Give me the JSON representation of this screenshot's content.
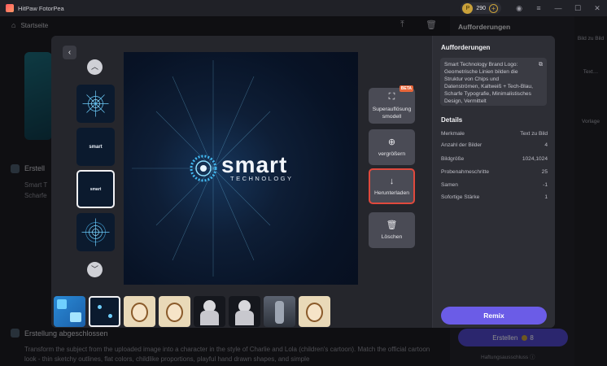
{
  "app": {
    "name": "HitPaw FotorPea"
  },
  "titlebar": {
    "credits": "290",
    "coin_symbol": "P",
    "plus": "+"
  },
  "header": {
    "home_label": "Startseite"
  },
  "right_panel": {
    "title": "Aufforderungen",
    "create_label": "Erstellen",
    "create_count": "8",
    "help_label": "Haftungsausschluss ⓘ"
  },
  "sidebar": {
    "items": [
      {
        "label": "Bild zu Bild"
      },
      {
        "label": "Text…"
      },
      {
        "label": "Vorlage"
      }
    ]
  },
  "background": {
    "item1_title": "Erstell",
    "item1_sub1": "Smart T",
    "item1_sub2": "Scharfe",
    "item2_title": "Erstellung abgeschlossen",
    "item2_text": "Transform the subject from the uploaded image into a character in the style of Charlie and Lola (children's cartoon). Match the official cartoon look - thin sketchy outlines, flat colors, childlike proportions, playful hand drawn shapes, and simple"
  },
  "modal": {
    "image": {
      "wordmark": "smart",
      "sub": "TECHNOLOGY"
    },
    "thumb_word": "smart",
    "actions": [
      {
        "label": "Superauflösungsmodell",
        "icon": "super-resolution-icon",
        "badge": "BETA"
      },
      {
        "label": "vergrößern",
        "icon": "zoom-in-icon"
      },
      {
        "label": "Herunterladen",
        "icon": "download-icon"
      },
      {
        "label": "Löschen",
        "icon": "trash-icon"
      }
    ],
    "side": {
      "prompt_title": "Aufforderungen",
      "prompt_text": "Smart Technology Brand Logo: Geometrische Linien bilden die Struktur von Chips und Datenströmen, Kaltweiß + Tech-Blau, Scharfe Typografie, Minimalistisches Design, Vermittelt",
      "details_title": "Details",
      "details": [
        {
          "label": "Merkmale",
          "value": "Text zu Bild"
        },
        {
          "label": "Anzahl der Bilder",
          "value": "4"
        },
        {
          "label": "Bildgröße",
          "value": "1024,1024"
        },
        {
          "label": "Probenahmeschritte",
          "value": "25"
        },
        {
          "label": "Samen",
          "value": "-1"
        },
        {
          "label": "Sofortige Stärke",
          "value": "1"
        }
      ],
      "remix_label": "Remix"
    }
  },
  "colors": {
    "accent": "#6b5ce7",
    "highlight": "#e0493d",
    "coin": "#c9a13a"
  }
}
